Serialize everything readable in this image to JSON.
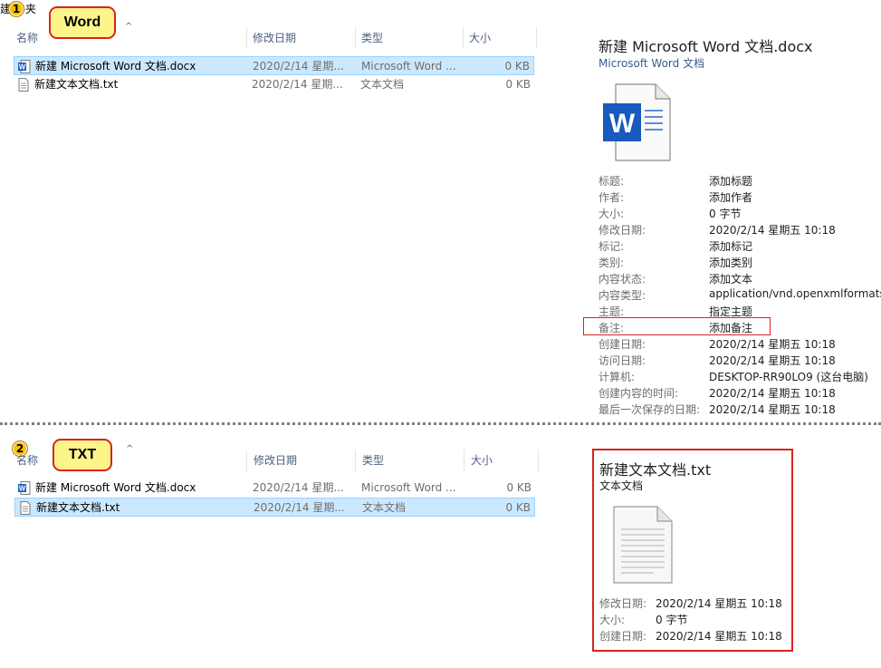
{
  "breadcrumb": "建 件夹",
  "badges": [
    "1",
    "2"
  ],
  "callouts": {
    "word": "Word",
    "txt": "TXT"
  },
  "columns": {
    "name": "名称",
    "date": "修改日期",
    "type": "类型",
    "size": "大小",
    "sort_arrow": "^"
  },
  "files": [
    {
      "name": "新建 Microsoft Word 文档.docx",
      "date": "2020/2/14 星期...",
      "type": "Microsoft Word ...",
      "size": "0 KB"
    },
    {
      "name": "新建文本文档.txt",
      "date": "2020/2/14 星期...",
      "type": "文本文档",
      "size": "0 KB"
    }
  ],
  "word_preview": {
    "title": "新建 Microsoft Word 文档.docx",
    "subtitle": "Microsoft Word 文档",
    "icon": "word-document-icon",
    "icon_letter": "W",
    "props": [
      {
        "label": "标题:",
        "value": "添加标题"
      },
      {
        "label": "作者:",
        "value": "添加作者"
      },
      {
        "label": "大小:",
        "value": "0 字节"
      },
      {
        "label": "修改日期:",
        "value": "2020/2/14 星期五 10:18"
      },
      {
        "label": "标记:",
        "value": "添加标记"
      },
      {
        "label": "类别:",
        "value": "添加类别"
      },
      {
        "label": "内容状态:",
        "value": "添加文本"
      },
      {
        "label": "内容类型:",
        "value": "application/vnd.openxmlformats-"
      },
      {
        "label": "主题:",
        "value": "指定主题"
      },
      {
        "label": "备注:",
        "value": "添加备注"
      },
      {
        "label": "创建日期:",
        "value": "2020/2/14 星期五 10:18"
      },
      {
        "label": "访问日期:",
        "value": "2020/2/14 星期五 10:18"
      },
      {
        "label": "计算机:",
        "value": "DESKTOP-RR90LO9 (这台电脑)"
      },
      {
        "label": "创建内容的时间:",
        "value": "2020/2/14 星期五 10:18"
      },
      {
        "label": "最后一次保存的日期:",
        "value": "2020/2/14 星期五 10:18"
      }
    ]
  },
  "txt_preview": {
    "title": "新建文本文档.txt",
    "subtitle": "文本文档",
    "icon": "text-document-icon",
    "props": [
      {
        "label": "修改日期:",
        "value": "2020/2/14 星期五 10:18"
      },
      {
        "label": "大小:",
        "value": "0 字节"
      },
      {
        "label": "创建日期:",
        "value": "2020/2/14 星期五 10:18"
      }
    ]
  },
  "colors": {
    "selection": "#cce8ff",
    "highlight": "#d9231f",
    "callout": "#fdf58a",
    "word_blue": "#185abd"
  }
}
